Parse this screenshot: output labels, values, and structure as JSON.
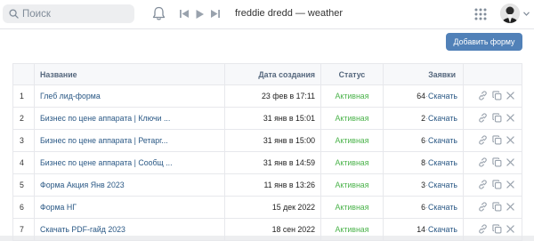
{
  "topbar": {
    "search_placeholder": "Поиск",
    "now_playing": "freddie dredd — weather"
  },
  "actions": {
    "add_form_label": "Добавить форму"
  },
  "table": {
    "headers": {
      "name": "Название",
      "created": "Дата создания",
      "status": "Статус",
      "leads": "Заявки"
    },
    "download_label": "Скачать",
    "separator": "·",
    "rows": [
      {
        "num": "1",
        "name": "Глеб лид-форма",
        "created": "23 фев в 17:11",
        "status": "Активная",
        "count": "64"
      },
      {
        "num": "2",
        "name": "Бизнес по цене аппарата | Ключи ...",
        "created": "31 янв в 15:01",
        "status": "Активная",
        "count": "2"
      },
      {
        "num": "3",
        "name": "Бизнес по цене аппарата | Ретарг...",
        "created": "31 янв в 15:00",
        "status": "Активная",
        "count": "6"
      },
      {
        "num": "4",
        "name": "Бизнес по цене аппарата | Сообщ ...",
        "created": "31 янв в 14:59",
        "status": "Активная",
        "count": "8"
      },
      {
        "num": "5",
        "name": "Форма Акция Янв 2023",
        "created": "11 янв в 13:26",
        "status": "Активная",
        "count": "3"
      },
      {
        "num": "6",
        "name": "Форма НГ",
        "created": "15 дек 2022",
        "status": "Активная",
        "count": "6"
      },
      {
        "num": "7",
        "name": "Скачать PDF-гайд 2023",
        "created": "18 сен 2022",
        "status": "Активная",
        "count": "14"
      }
    ]
  },
  "colors": {
    "accent": "#5181b8",
    "link": "#2a5885",
    "status_active": "#4bb34b",
    "icon": "#99a2ad"
  }
}
